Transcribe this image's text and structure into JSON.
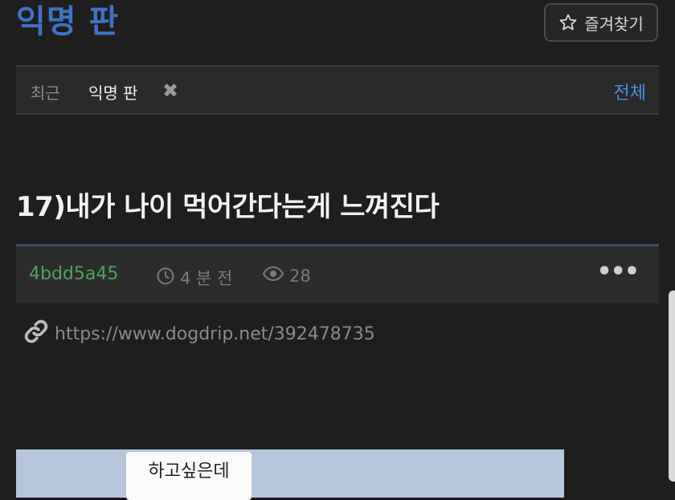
{
  "board": {
    "title": "익명 판"
  },
  "favorite": {
    "label": "즐겨찾기",
    "icon": "star-outline-icon"
  },
  "recent": {
    "label": "최근",
    "item": "익명 판",
    "close_glyph": "✖",
    "all_label": "전체"
  },
  "post": {
    "title": "17)내가 나이 먹어간다는게 느껴진다",
    "author": "4bdd5a45",
    "time": "4 분 전",
    "views": "28",
    "more_glyph": "•••",
    "url": "https://www.dogdrip.net/392478735"
  },
  "content": {
    "image_caption": "하고싶은데",
    "image_extra": "—"
  },
  "colors": {
    "brand": "#3f73c4",
    "author": "#4fa35a",
    "link": "#4a8fe0",
    "background": "#1e1e1f"
  }
}
